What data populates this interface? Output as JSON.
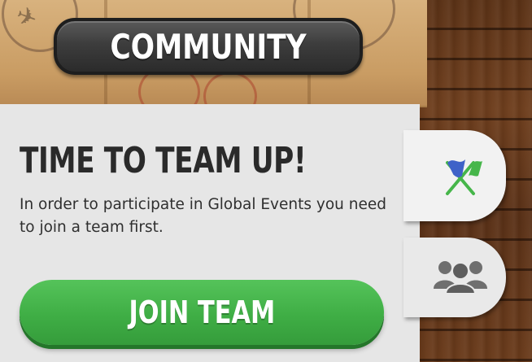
{
  "header": {
    "title": "COMMUNITY"
  },
  "panel": {
    "heading": "TIME TO TEAM UP!",
    "description": "In order to participate in Global Events you need to join a team first.",
    "join_button_label": "JOIN TEAM"
  },
  "tabs": [
    {
      "icon": "crossed-flags-icon",
      "active": true
    },
    {
      "icon": "team-group-icon",
      "active": false
    }
  ],
  "colors": {
    "button_green": "#3fae45",
    "panel_bg": "#e6e6e6",
    "banner_dark": "#2b2b2b",
    "flag_blue": "#3f62c8",
    "flag_green": "#46b64a",
    "team_icon_gray": "#6f6f6f"
  }
}
